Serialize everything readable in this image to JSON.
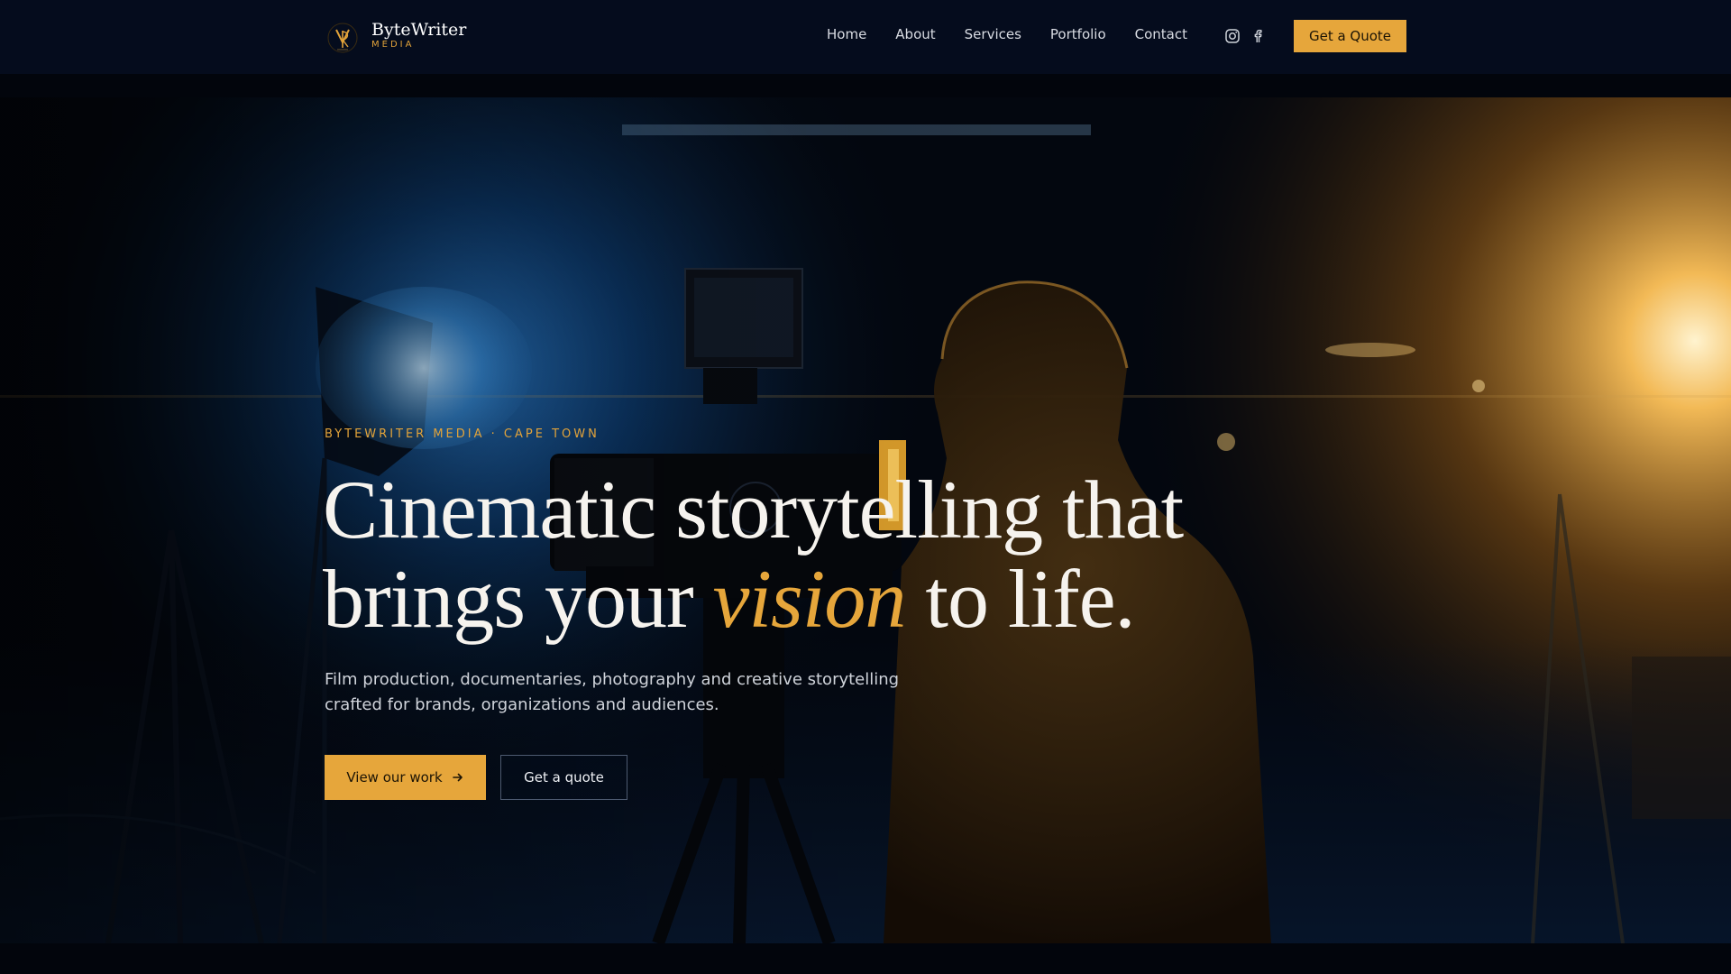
{
  "brand": {
    "name": "ByteWriter",
    "subtitle": "MEDIA"
  },
  "nav": {
    "links": [
      "Home",
      "About",
      "Services",
      "Portfolio",
      "Contact"
    ],
    "quote_label": "Get a Quote",
    "social_icons": [
      "instagram-icon",
      "facebook-icon"
    ]
  },
  "hero": {
    "eyebrow": "BYTEWRITER MEDIA · CAPE TOWN",
    "headline_line1": "Cinematic storytelling that",
    "headline_line2_before": "brings your ",
    "headline_accent": "vision",
    "headline_line2_after": " to life.",
    "lead": "Film production, documentaries, photography and creative storytelling crafted for brands, organizations and audiences.",
    "primary_cta": "View our work",
    "secondary_cta": "Get a quote"
  },
  "colors": {
    "accent": "#e6a63b",
    "nav_bg": "#050c1d",
    "page_bg": "#02050c",
    "headline": "#f6f3ee"
  }
}
